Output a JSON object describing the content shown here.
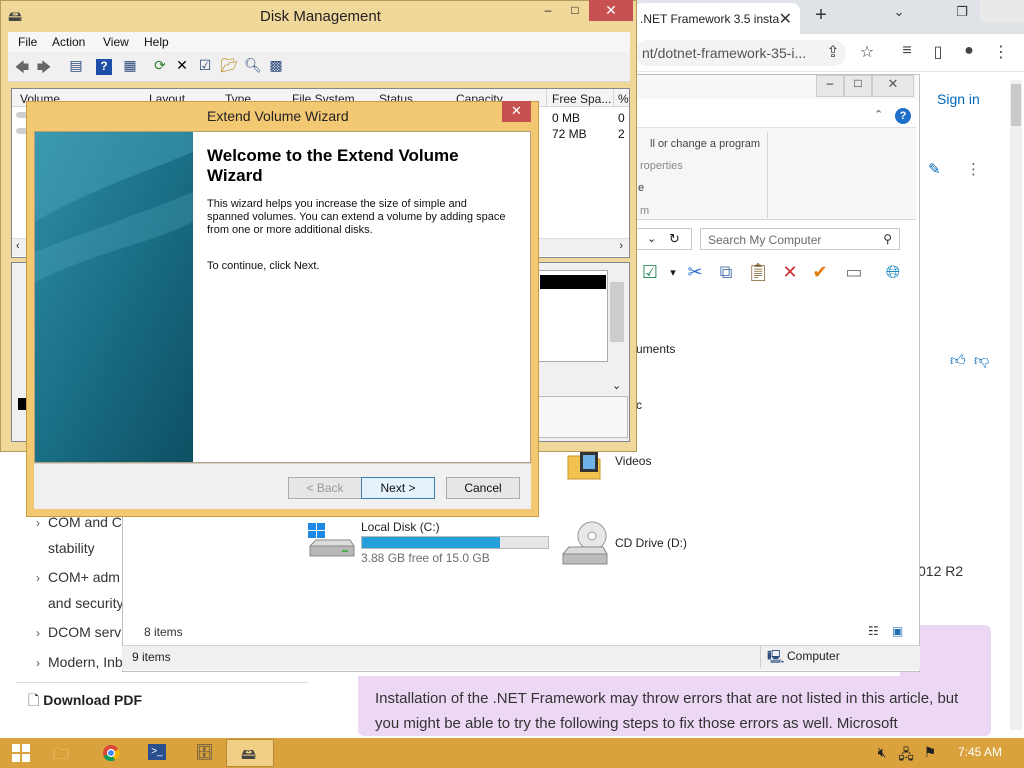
{
  "browser": {
    "tab_title": ".NET Framework 3.5 insta",
    "tab_close": "✕",
    "new_tab": "+",
    "url": "nt/dotnet-framework-35-i...",
    "sign_in": "Sign in"
  },
  "article": {
    "items": [
      {
        "label": "COM and CO",
        "sub": "stability"
      },
      {
        "label": "COM+ adm",
        "sub": "and security"
      },
      {
        "label": "DCOM servi"
      },
      {
        "label": "Modern, Inb"
      }
    ],
    "download_pdf": "Download PDF",
    "right_text": "012 R2",
    "note": "Installation of the .NET Framework may throw errors that are not listed in this article, but you might be able to try the following steps to fix those errors as well. Microsoft"
  },
  "explorer": {
    "ribbon_uninstall": "ll or change a program",
    "ribbon_properties": "roperties",
    "ribbon_e": "e",
    "ribbon_m": "m",
    "search_placeholder": "Search My Computer",
    "folders": {
      "documents": "uments",
      "music": "c",
      "videos": "Videos"
    },
    "drive_c": {
      "name": "Local Disk (C:)",
      "free": "3.88 GB free of 15.0 GB",
      "used_fraction": 0.74
    },
    "drive_d": {
      "name": "CD Drive (D:)"
    },
    "status_items_a": "8 items",
    "status_items_b": "9 items",
    "status_location": "Computer"
  },
  "disk_management": {
    "title": "Disk Management",
    "menu": [
      "File",
      "Action",
      "View",
      "Help"
    ],
    "columns": [
      "Volume",
      "Layout",
      "Type",
      "File System",
      "Status",
      "Capacity",
      "Free Spa...",
      "%"
    ],
    "rows": [
      {
        "free": "0 MB",
        "pct": "0"
      },
      {
        "free": "72 MB",
        "pct": "2"
      }
    ]
  },
  "wizard": {
    "title": "Extend Volume Wizard",
    "heading": "Welcome to the Extend Volume Wizard",
    "description": "This wizard helps you increase the size of simple and spanned volumes. You can extend a volume  by adding space from one or more additional disks.",
    "continue_text": "To continue, click Next.",
    "back_label": "< Back",
    "next_label": "Next >",
    "cancel_label": "Cancel"
  },
  "taskbar": {
    "clock": "7:45 AM"
  },
  "colors": {
    "accent_blue": "#26a0da",
    "window_frame": "#f3c872",
    "close_red": "#c75050",
    "taskbar": "#d9a23c",
    "note_bg": "#ecd8f5"
  }
}
